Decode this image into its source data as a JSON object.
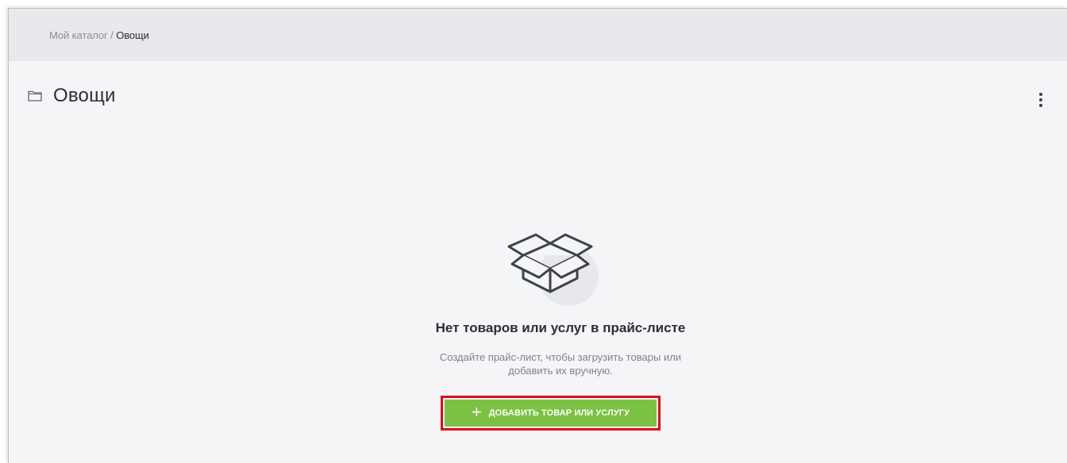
{
  "breadcrumb": {
    "root": "Мой каталог",
    "separator": " / ",
    "current": "Овощи"
  },
  "page": {
    "title": "Овощи",
    "folder_icon": "folder-icon",
    "menu_icon": "more-vertical-icon"
  },
  "empty_state": {
    "icon": "open-box-icon",
    "title": "Нет товаров или услуг в прайс-листе",
    "description_line1": "Создайте прайс-лист, чтобы загрузить товары или",
    "description_line2": "добавить их вручную.",
    "button_icon": "+",
    "button_label": "ДОБАВИТЬ ТОВАР ИЛИ УСЛУГУ"
  },
  "colors": {
    "accent_green": "#7bc143",
    "highlight_red": "#e30613",
    "background": "#f4f5f7",
    "topbar": "#e7e9ec"
  }
}
